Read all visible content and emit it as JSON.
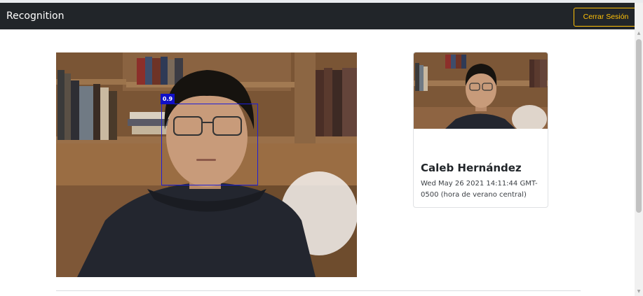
{
  "navbar": {
    "brand": "Recognition",
    "logout_label": "Cerrar Sesión",
    "colors": {
      "background": "#212529",
      "accent": "#ffc107"
    }
  },
  "camera": {
    "detection_score": "0.9",
    "box_color": "#1f1fd6"
  },
  "result_card": {
    "name": "Caleb Hernández",
    "timestamp": "Wed May 26 2021 14:11:44 GMT-0500 (hora de verano central)"
  },
  "icons": {
    "scroll_up": "triangle-up-icon",
    "scroll_down": "triangle-down-icon"
  }
}
